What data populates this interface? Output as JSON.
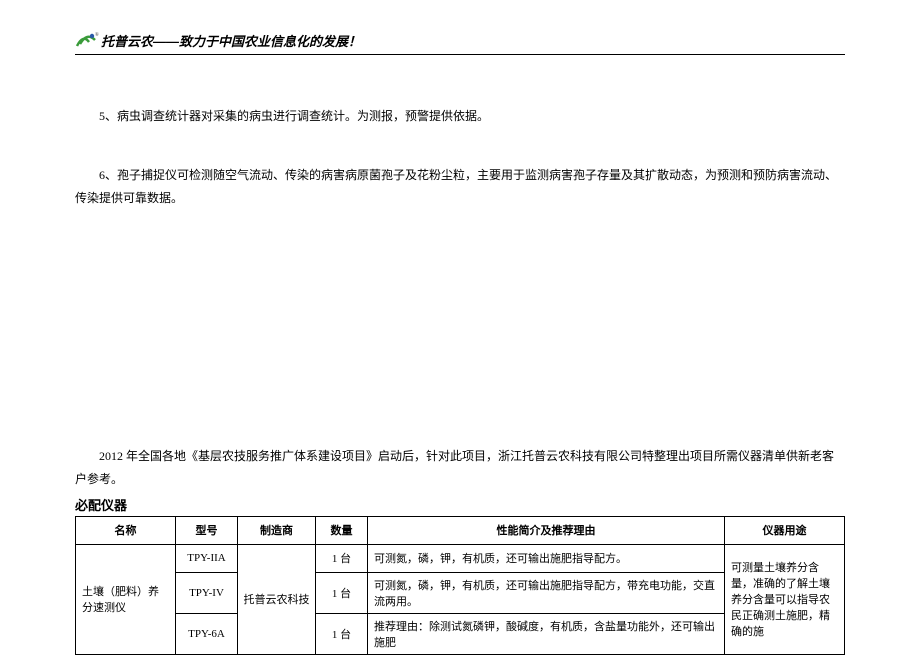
{
  "header": {
    "company": "托普云农",
    "separator": "——",
    "slogan": "致力于中国农业信息化的发展！"
  },
  "paragraphs": {
    "p5": "5、病虫调查统计器对采集的病虫进行调查统计。为测报，预警提供依据。",
    "p6": "6、孢子捕捉仪可检测随空气流动、传染的病害病原菌孢子及花粉尘粒，主要用于监测病害孢子存量及其扩散动态，为预测和预防病害流动、传染提供可靠数据。"
  },
  "intro": "2012 年全国各地《基层农技服务推广体系建设项目》启动后，针对此项目，浙江托普云农科技有限公司特整理出项目所需仪器清单供新老客户参考。",
  "section_title": "必配仪器",
  "table": {
    "headers": {
      "name": "名称",
      "model": "型号",
      "maker": "制造商",
      "qty": "数量",
      "perf": "性能简介及推荐理由",
      "use": "仪器用途"
    },
    "product_name": "土壤（肥料）养分速测仪",
    "maker": "托普云农科技",
    "use": "可测量土壤养分含量，准确的了解土壤养分含量可以指导农民正确测土施肥，精确的施",
    "rows": [
      {
        "model": "TPY-IIA",
        "qty": "1 台",
        "perf": "可测氮，磷，钾，有机质，还可输出施肥指导配方。"
      },
      {
        "model": "TPY-IV",
        "qty": "1 台",
        "perf": "可测氮，磷，钾，有机质，还可输出施肥指导配方，带充电功能，交直流两用。"
      },
      {
        "model": "TPY-6A",
        "qty": "1 台",
        "perf": "推荐理由：除测试氮磷钾，酸碱度，有机质，含盐量功能外，还可输出施肥"
      }
    ]
  }
}
